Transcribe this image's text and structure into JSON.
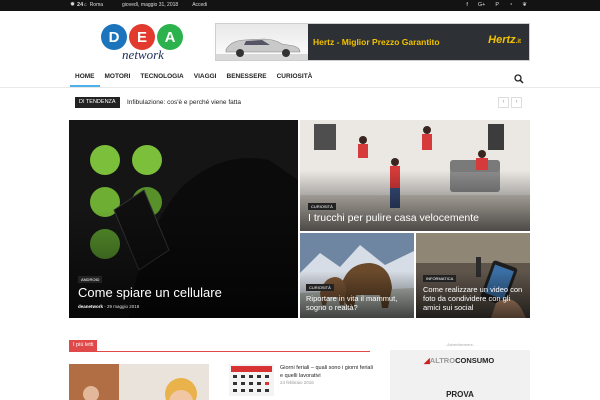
{
  "topbar": {
    "weather_icon": "sun-icon",
    "temperature": "24",
    "degree_unit": "C",
    "city": "Roma",
    "date": "giovedì, maggio 31, 2018",
    "login": "Accedi",
    "social_icons": [
      "facebook-icon",
      "google-plus-icon",
      "pinterest-icon",
      "rss-icon",
      "twitter-icon"
    ]
  },
  "logo": {
    "line1": "DEA",
    "line2": "network",
    "colors": [
      "#1c75bc",
      "#e23b2e",
      "#2bb24c"
    ]
  },
  "ad_banner": {
    "text": "Hertz - Miglior Prezzo Garantito",
    "brand": "Hertz",
    "brand_suffix": ".it"
  },
  "nav": {
    "items": [
      "HOME",
      "MOTORI",
      "TECNOLOGIA",
      "VIAGGI",
      "BENESSERE",
      "CURIOSITÀ"
    ],
    "active_color": "#4db2ec"
  },
  "trending": {
    "label": "DI TENDENZA",
    "headline": "Infibulazione: cos'è e perché viene fatta",
    "prev": "‹",
    "next": "›"
  },
  "featured": {
    "main": {
      "category": "ANDROID",
      "title": "Come spiare un cellulare",
      "author": "deanetwork",
      "date": "29 maggio 2018"
    },
    "top_right": {
      "category": "CURIOSITÀ",
      "title": "I trucchi per pulire casa velocemente"
    },
    "bottom_left": {
      "category": "CURIOSITÀ",
      "title": "Riportare in vita il mammut, sogno o realtà?"
    },
    "bottom_right": {
      "category": "INFORMATICA",
      "title": "Come realizzare un video con foto da condividere con gli amici sui social"
    }
  },
  "section": {
    "tag": "I più letti",
    "post_title": "Giorni feriali – quali sono i giorni feriali e quelli lavorativi",
    "post_date": "24 febbraio 2016"
  },
  "advert": {
    "label": "- Advertisement -",
    "brand_part1": "ALTRO",
    "brand_part2": "CONSUMO",
    "cta": "PROVA"
  },
  "colors": {
    "accent": "#4db2ec",
    "section_red": "#e04949",
    "topbar_bg": "#131313"
  }
}
